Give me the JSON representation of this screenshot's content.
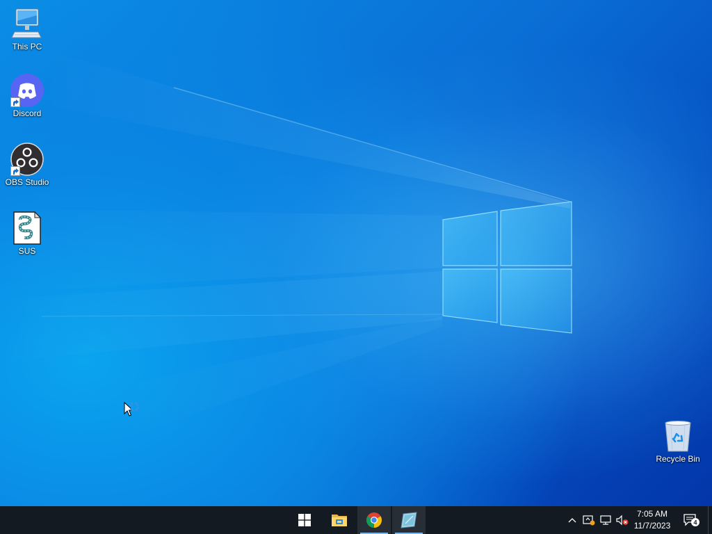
{
  "desktop": {
    "icons": [
      {
        "label": "This PC"
      },
      {
        "label": "Discord"
      },
      {
        "label": "OBS Studio"
      },
      {
        "label": "SUS"
      },
      {
        "label": "Recycle Bin"
      }
    ],
    "icon_names": [
      "this-pc-icon",
      "discord-icon",
      "obs-studio-icon",
      "sus-file-icon",
      "recycle-bin-icon"
    ],
    "wallpaper": "windows-10-hero",
    "wallpaper_colors": {
      "light": "#0aa4ef",
      "mid": "#0a7fe0",
      "dark": "#0336a8"
    }
  },
  "taskbar": {
    "pinned": [
      {
        "name": "start-button",
        "icon": "windows-logo-icon"
      },
      {
        "name": "file-explorer",
        "icon": "folder-icon"
      },
      {
        "name": "google-chrome",
        "icon": "chrome-icon"
      },
      {
        "name": "active-app",
        "icon": "app-window-icon",
        "active": true
      }
    ],
    "tray": {
      "icons": [
        "chevron-up-icon",
        "security-warning-icon",
        "network-icon",
        "volume-muted-icon"
      ],
      "time": "7:05 AM",
      "date": "11/7/2023",
      "notification_count": "4"
    },
    "background": "#131a22"
  }
}
